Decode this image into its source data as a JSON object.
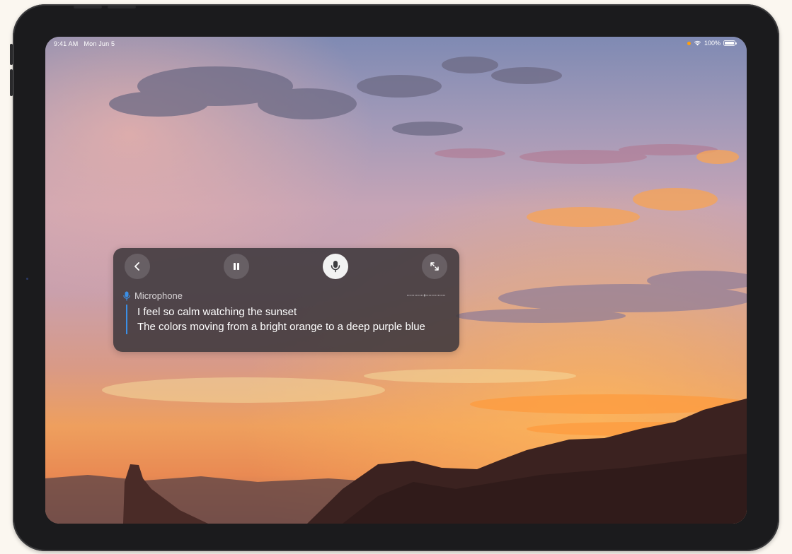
{
  "status_bar": {
    "time": "9:41 AM",
    "date": "Mon Jun 5",
    "battery": "100%",
    "icons": [
      "privacy-indicator-dot",
      "wifi-icon",
      "battery-icon"
    ]
  },
  "live_captions": {
    "controls": [
      {
        "name": "back",
        "icon": "chevron-left-icon"
      },
      {
        "name": "pause",
        "icon": "pause-icon"
      },
      {
        "name": "microphone",
        "icon": "microphone-icon",
        "active": true
      },
      {
        "name": "expand",
        "icon": "expand-icon"
      }
    ],
    "source_label": "Microphone",
    "source_icon": "microphone-icon",
    "lines": [
      "I feel so calm watching the sunset",
      "The colors moving from a bright orange to a deep purple blue"
    ],
    "accent_color": "#3b8fe6"
  },
  "wallpaper": {
    "description_colors": [
      "#8b8fb8",
      "#c9a6b6",
      "#f2a45a",
      "#3a2522"
    ]
  }
}
